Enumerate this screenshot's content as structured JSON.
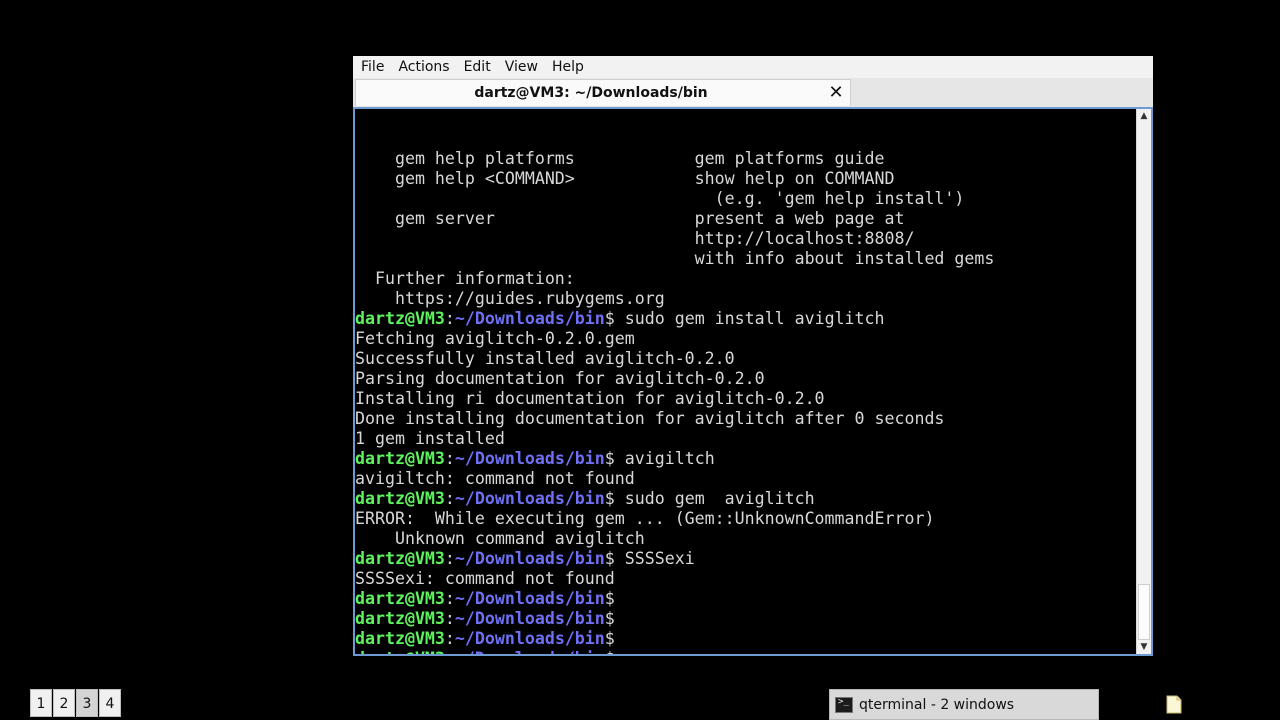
{
  "menubar": {
    "items": [
      "File",
      "Actions",
      "Edit",
      "View",
      "Help"
    ]
  },
  "tab": {
    "title": "dartz@VM3: ~/Downloads/bin",
    "close_glyph": "✕"
  },
  "terminal": {
    "prompt": {
      "user_host": "dartz@VM3",
      "colon": ":",
      "path": "~/Downloads/bin",
      "dollar": "$ "
    },
    "colors": {
      "user": "#5ff25f",
      "path": "#6f6ff5",
      "text": "#d8d8d8",
      "background": "#000000"
    },
    "lines": [
      {
        "type": "text",
        "text": "    gem help platforms            gem platforms guide"
      },
      {
        "type": "text",
        "text": "    gem help <COMMAND>            show help on COMMAND"
      },
      {
        "type": "text",
        "text": "                                    (e.g. 'gem help install')"
      },
      {
        "type": "text",
        "text": "    gem server                    present a web page at"
      },
      {
        "type": "text",
        "text": "                                  http://localhost:8808/"
      },
      {
        "type": "text",
        "text": "                                  with info about installed gems"
      },
      {
        "type": "text",
        "text": "  Further information:"
      },
      {
        "type": "text",
        "text": "    https://guides.rubygems.org"
      },
      {
        "type": "prompt",
        "text": "sudo gem install aviglitch"
      },
      {
        "type": "text",
        "text": "Fetching aviglitch-0.2.0.gem"
      },
      {
        "type": "text",
        "text": "Successfully installed aviglitch-0.2.0"
      },
      {
        "type": "text",
        "text": "Parsing documentation for aviglitch-0.2.0"
      },
      {
        "type": "text",
        "text": "Installing ri documentation for aviglitch-0.2.0"
      },
      {
        "type": "text",
        "text": "Done installing documentation for aviglitch after 0 seconds"
      },
      {
        "type": "text",
        "text": "1 gem installed"
      },
      {
        "type": "prompt",
        "text": "avigiltch"
      },
      {
        "type": "text",
        "text": "avigiltch: command not found"
      },
      {
        "type": "prompt",
        "text": "sudo gem  aviglitch"
      },
      {
        "type": "text",
        "text": "ERROR:  While executing gem ... (Gem::UnknownCommandError)"
      },
      {
        "type": "text",
        "text": "    Unknown command aviglitch"
      },
      {
        "type": "prompt",
        "text": "SSSSexi"
      },
      {
        "type": "text",
        "text": "SSSSexi: command not found"
      },
      {
        "type": "prompt",
        "text": ""
      },
      {
        "type": "prompt",
        "text": ""
      },
      {
        "type": "prompt",
        "text": ""
      },
      {
        "type": "prompt",
        "text": ""
      },
      {
        "type": "prompt",
        "text": "",
        "cursor": true
      }
    ]
  },
  "scrollbar": {
    "up_glyph": "▲",
    "down_glyph": "▼"
  },
  "taskbar": {
    "workspaces": [
      "1",
      "2",
      "3",
      "4"
    ],
    "active_workspace": "3",
    "task_label": "qterminal - 2 windows"
  },
  "icons": {
    "task": "terminal-icon",
    "tray": "note-icon"
  }
}
